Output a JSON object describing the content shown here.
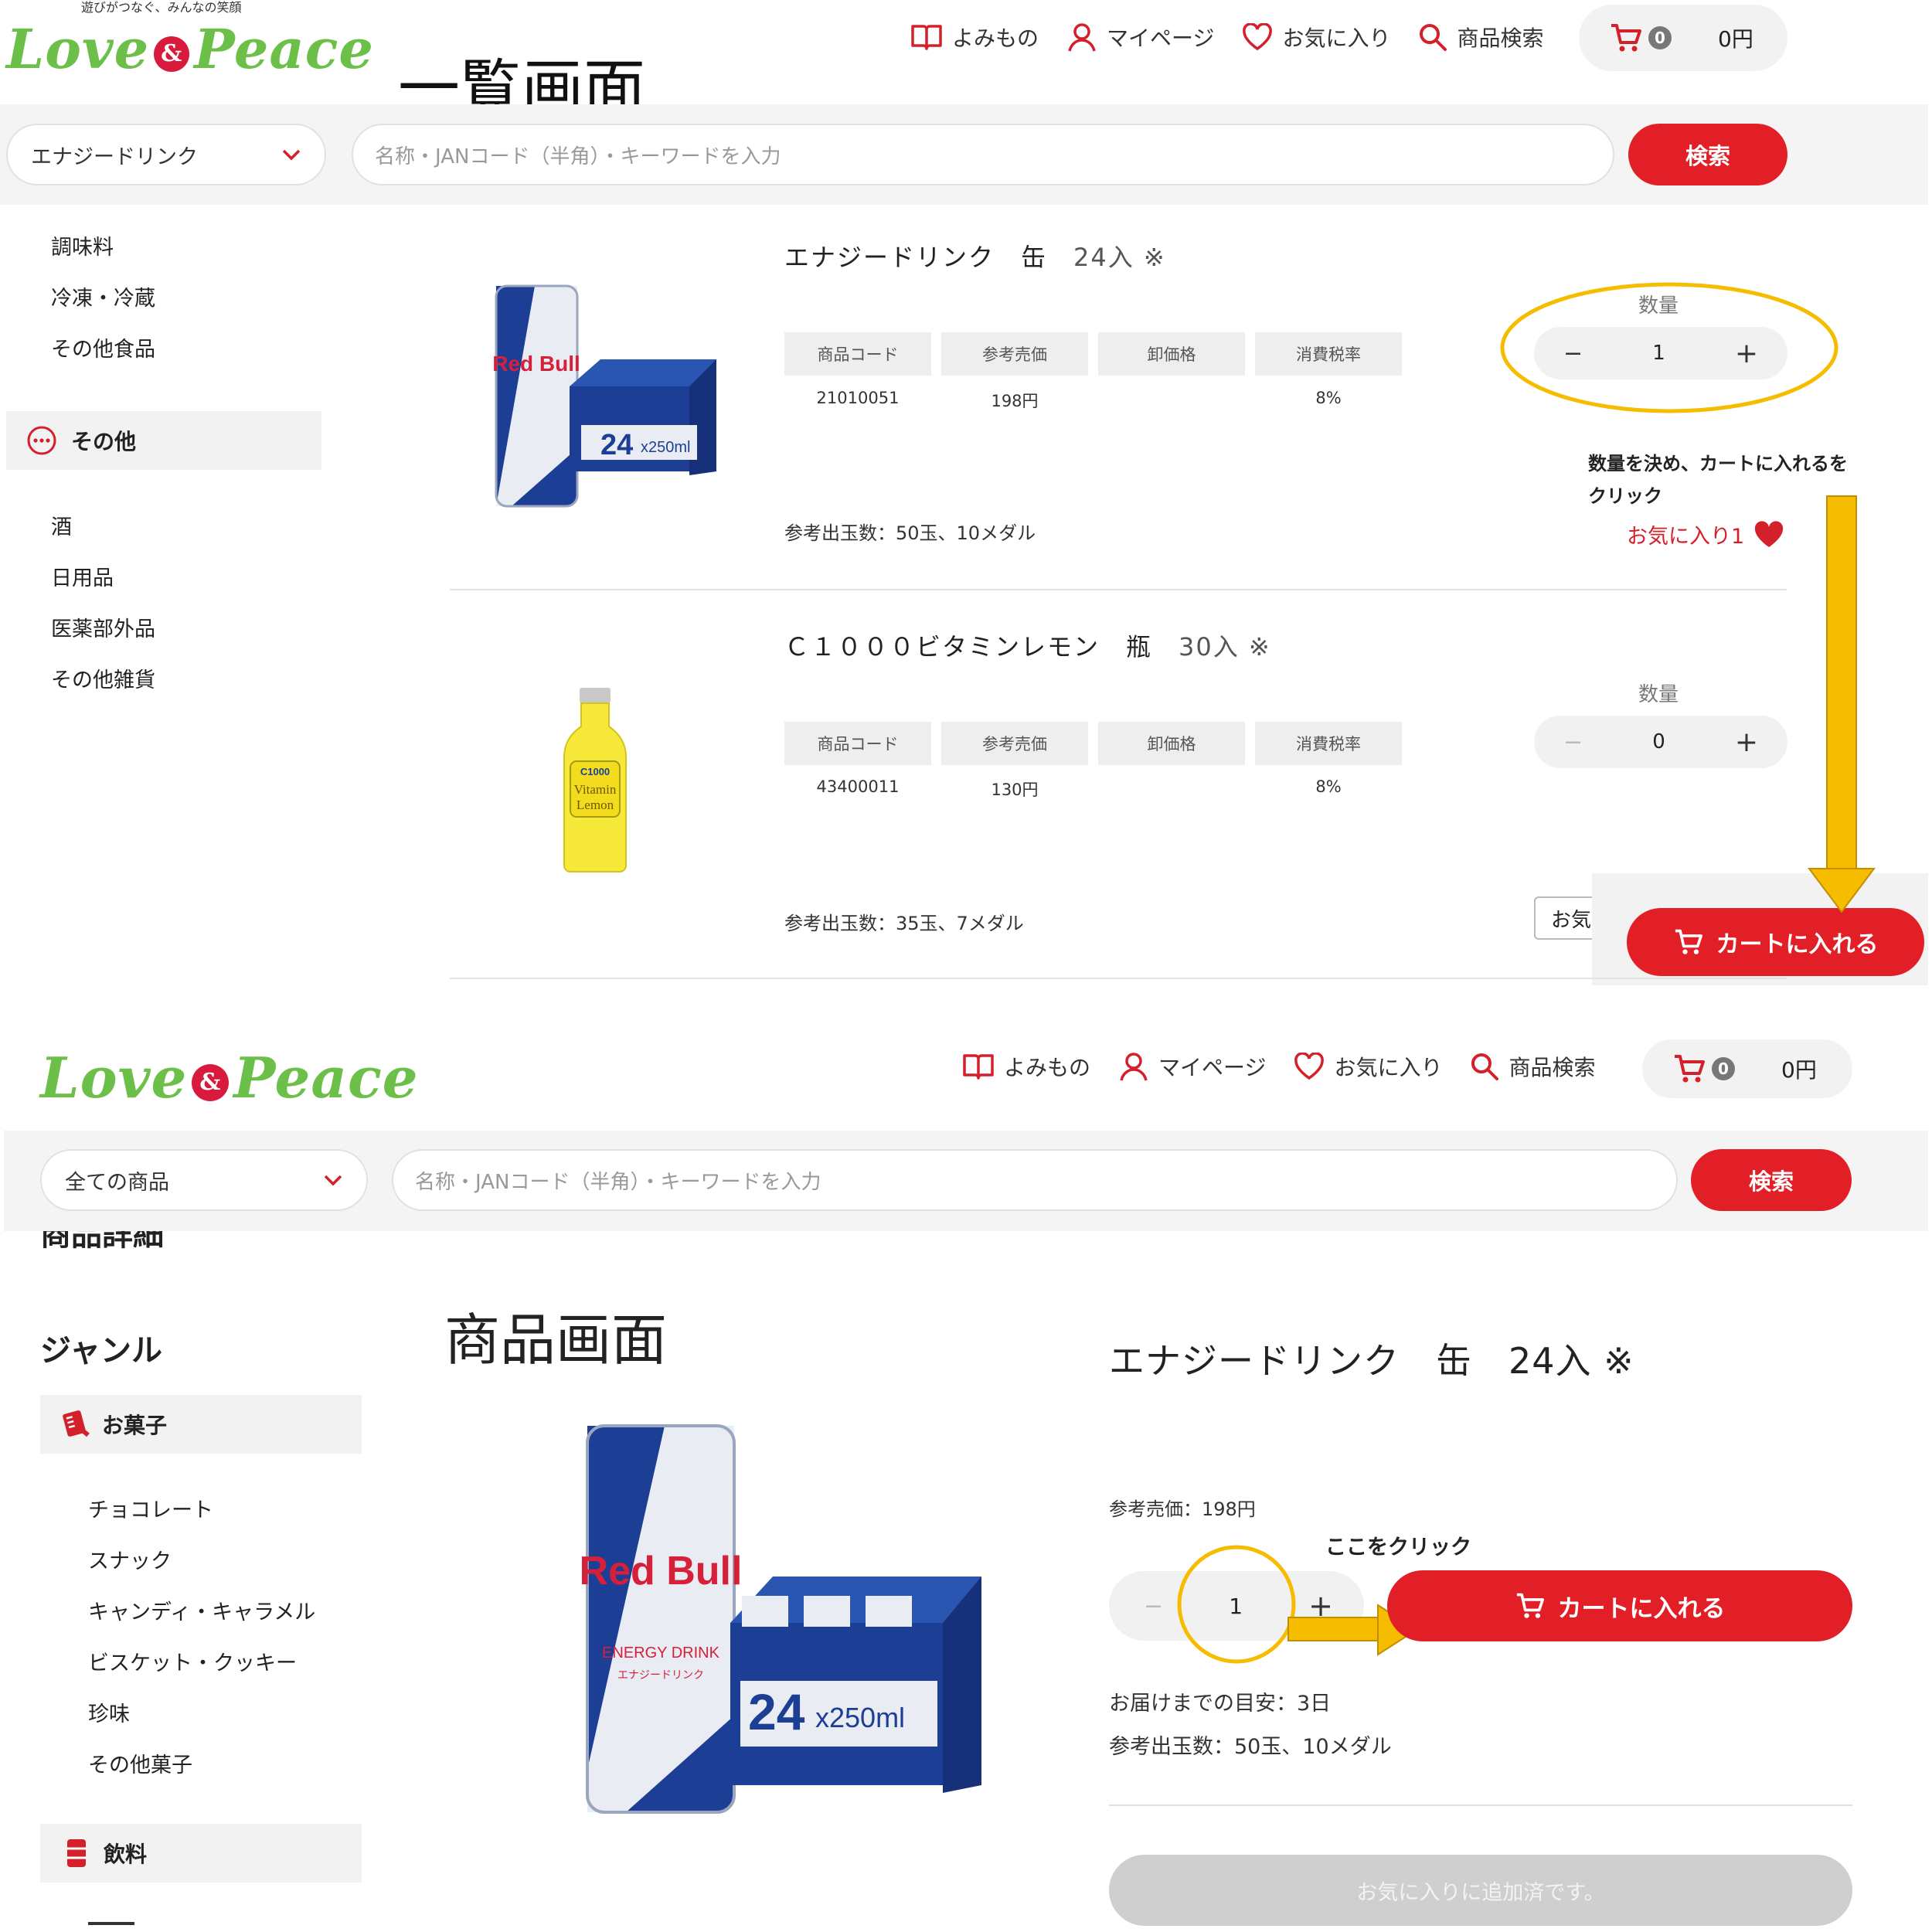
{
  "top": {
    "logo_tagline": "遊びがつなぐ、みんなの笑顔",
    "logo_word1": "Love",
    "logo_amp": "&",
    "logo_word2": "Peace",
    "screen_label": "一覧画面",
    "nav": {
      "reading": "よみもの",
      "mypage": "マイページ",
      "favorites": "お気に入り",
      "search": "商品検索"
    },
    "cart_count": "0",
    "cart_total": "0円",
    "category_select": "エナジードリンク",
    "search_placeholder": "名称・JANコード（半角）・キーワードを入力",
    "search_button": "検索",
    "sidebar": {
      "item1": "調味料",
      "item2": "冷凍・冷蔵",
      "item3": "その他食品",
      "group": "その他",
      "item4": "酒",
      "item5": "日用品",
      "item6": "医薬部外品",
      "item7": "その他雑貨"
    },
    "products": [
      {
        "name": "エナジードリンク　缶",
        "count": "24入 ※",
        "headers": [
          "商品コード",
          "参考売価",
          "卸価格",
          "消費税率"
        ],
        "code": "21010051",
        "price": "198円",
        "wholesale": "",
        "tax": "8%",
        "payout": "参考出玉数：50玉、10メダル",
        "qty_label": "数量",
        "qty": "1",
        "favorite": "お気に入り1"
      },
      {
        "name": "Ｃ１０００ビタミンレモン　瓶",
        "count": "30入 ※",
        "headers": [
          "商品コード",
          "参考売価",
          "卸価格",
          "消費税率"
        ],
        "code": "43400011",
        "price": "130円",
        "wholesale": "",
        "tax": "8%",
        "payout": "参考出玉数：35玉、7メダル",
        "qty_label": "数量",
        "qty": "0",
        "favorite_partial": "お気"
      }
    ],
    "instruction": "数量を決め、カートに入れるを",
    "instruction2": "クリック",
    "add_to_cart": "カートに入れる",
    "minus": "−",
    "plus": "+"
  },
  "bottom": {
    "nav": {
      "reading": "よみもの",
      "mypage": "マイページ",
      "favorites": "お気に入り",
      "search": "商品検索"
    },
    "cart_count": "0",
    "cart_total": "0円",
    "category_select": "全ての商品",
    "search_placeholder": "名称・JANコード（半角）・キーワードを入力",
    "search_button": "検索",
    "cut_heading": "商品詳細",
    "screen_label": "商品画面",
    "genre_heading": "ジャンル",
    "genre_sweets": "お菓子",
    "sweets_items": [
      "チョコレート",
      "スナック",
      "キャンディ・キャラメル",
      "ビスケット・クッキー",
      "珍味",
      "その他菓子"
    ],
    "genre_drinks": "飲料",
    "product_title": "エナジードリンク　缶　24入 ※",
    "ref_price": "参考売価：198円",
    "click_here": "ここをクリック",
    "qty": "1",
    "minus": "−",
    "plus": "+",
    "add_to_cart": "カートに入れる",
    "delivery": "お届けまでの目安：3日",
    "payout": "参考出玉数：50玉、10メダル",
    "favorite_added": "お気に入りに追加済です。"
  },
  "images": {
    "can_brand": "Red Bull",
    "can_sub": "ENERGY DRINK",
    "can_jp": "エナジードリンク",
    "case_text": "24",
    "case_size": "x250ml",
    "bottle_label1": "C1000",
    "bottle_label2": "Vitamin",
    "bottle_label3": "Lemon"
  },
  "colors": {
    "brand_red": "#e21f26",
    "logo_green": "#6cc04a",
    "annot_yellow": "#f5bc00",
    "heart_red": "#d4202a"
  }
}
